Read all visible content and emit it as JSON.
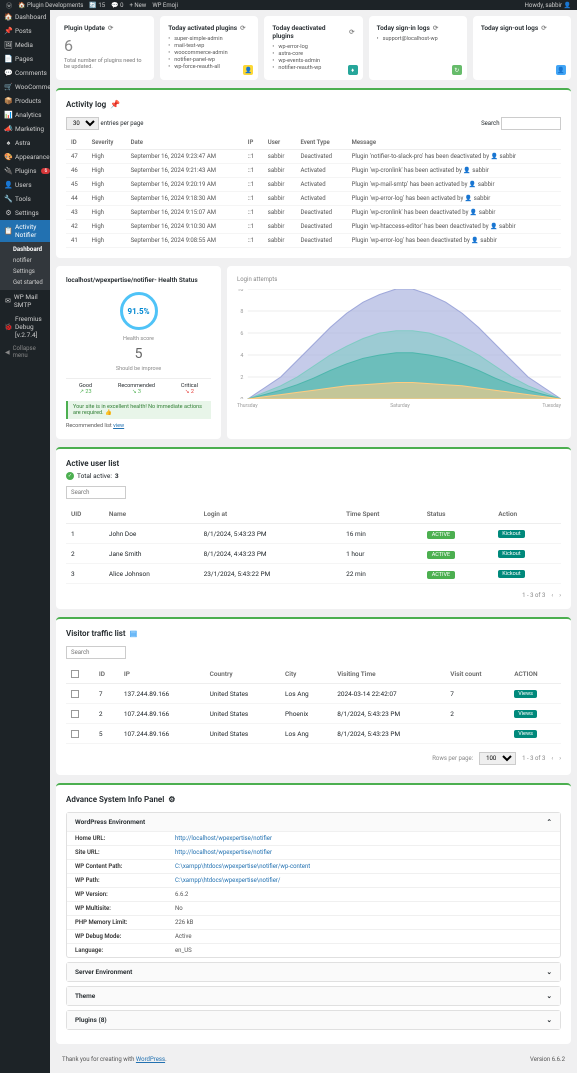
{
  "adminbar": {
    "site": "Plugin Developments",
    "updates": "15",
    "comments": "0",
    "new": "New",
    "wpemoji": "WP Emoji",
    "howdy": "Howdy, sabbir"
  },
  "sidebar": {
    "items": [
      {
        "icon": "🏠",
        "label": "Dashboard"
      },
      {
        "icon": "📌",
        "label": "Posts"
      },
      {
        "icon": "🖼",
        "label": "Media"
      },
      {
        "icon": "📄",
        "label": "Pages"
      },
      {
        "icon": "💬",
        "label": "Comments"
      },
      {
        "icon": "🛒",
        "label": "WooCommerce"
      },
      {
        "icon": "📦",
        "label": "Products"
      },
      {
        "icon": "📊",
        "label": "Analytics"
      },
      {
        "icon": "📣",
        "label": "Marketing"
      },
      {
        "icon": "♠",
        "label": "Astra"
      },
      {
        "icon": "🎨",
        "label": "Appearance"
      },
      {
        "icon": "🔌",
        "label": "Plugins",
        "badge": "6"
      },
      {
        "icon": "👤",
        "label": "Users"
      },
      {
        "icon": "🔧",
        "label": "Tools"
      },
      {
        "icon": "⚙",
        "label": "Settings"
      },
      {
        "icon": "📋",
        "label": "Activity Notifier",
        "current": true
      },
      {
        "icon": "✉",
        "label": "WP Mail SMTP"
      },
      {
        "icon": "🐞",
        "label": "Freemius Debug [v.2.7.4]"
      }
    ],
    "sub": [
      "Dashboard",
      "notifier",
      "Settings",
      "Get started"
    ],
    "collapse": "Collapse menu"
  },
  "cards": {
    "update": {
      "title": "Plugin Update",
      "count": "6",
      "note": "Total number of plugins need to be updated."
    },
    "activated": {
      "title": "Today activated plugins",
      "items": [
        "super-simple-admin",
        "mail-test-wp",
        "woocommerce-admin",
        "notifier-panel-wp",
        "wp-force-reauth-all"
      ]
    },
    "deactivated": {
      "title": "Today deactivated plugins",
      "items": [
        "wp-error-log",
        "astra-core",
        "wp-events-admin",
        "notifier-reauth-wp"
      ]
    },
    "signin": {
      "title": "Today sign-in logs",
      "items": [
        "support@localhost-wp"
      ]
    },
    "signout": {
      "title": "Today sign-out logs",
      "items": []
    }
  },
  "activity": {
    "title": "Activity log",
    "perpage": "30",
    "perpage_label": "entries per page",
    "search": "Search",
    "headers": [
      "ID",
      "Severity",
      "Date",
      "IP",
      "User",
      "Event Type",
      "Message"
    ],
    "rows": [
      {
        "id": "47",
        "sev": "High",
        "date": "September 16, 2024 9:23:47 AM",
        "ip": "::1",
        "user": "sabbir",
        "event": "Deactivated",
        "msg": "Plugin 'notifier-to-slack-pro' has been deactivated by 👤 sabbir"
      },
      {
        "id": "46",
        "sev": "High",
        "date": "September 16, 2024 9:21:43 AM",
        "ip": "::1",
        "user": "sabbir",
        "event": "Activated",
        "msg": "Plugin 'wp-cronlink' has been activated by 👤 sabbir"
      },
      {
        "id": "45",
        "sev": "High",
        "date": "September 16, 2024 9:20:19 AM",
        "ip": "::1",
        "user": "sabbir",
        "event": "Activated",
        "msg": "Plugin 'wp-mail-smtp' has been activated by 👤 sabbir"
      },
      {
        "id": "44",
        "sev": "High",
        "date": "September 16, 2024 9:18:30 AM",
        "ip": "::1",
        "user": "sabbir",
        "event": "Activated",
        "msg": "Plugin 'wp-error-log' has been activated by 👤 sabbir"
      },
      {
        "id": "43",
        "sev": "High",
        "date": "September 16, 2024 9:15:07 AM",
        "ip": "::1",
        "user": "sabbir",
        "event": "Deactivated",
        "msg": "Plugin 'wp-cronlink' has been deactivated by 👤 sabbir"
      },
      {
        "id": "42",
        "sev": "High",
        "date": "September 16, 2024 9:10:30 AM",
        "ip": "::1",
        "user": "sabbir",
        "event": "Deactivated",
        "msg": "Plugin 'wp-htaccess-editor' has been deactivated by 👤 sabbir"
      },
      {
        "id": "41",
        "sev": "High",
        "date": "September 16, 2024 9:08:55 AM",
        "ip": "::1",
        "user": "sabbir",
        "event": "Deactivated",
        "msg": "Plugin 'wp-error-log' has been deactivated by 👤 sabbir"
      }
    ]
  },
  "health": {
    "title": "localhost/wpexpertise/notifier- Health Status",
    "score": "91.5%",
    "score_label": "Health score",
    "count": "5",
    "count_label": "Should be improve",
    "good": "Good",
    "good_val": "↗ 23",
    "rec": "Recommended",
    "rec_val": "↘ 3",
    "crit": "Critical",
    "crit_val": "↘ 2",
    "tip": "Your site is in excellent health! No immediate actions are required. 👍",
    "link_pre": "Recommended list ",
    "link": "view"
  },
  "chart_data": {
    "title": "Login attempts",
    "type": "area",
    "x": [
      "Thursday",
      "Saturday",
      "Tuesday"
    ],
    "series": [
      {
        "name": "s1",
        "color": "#9fa8da",
        "values": [
          0,
          10,
          20,
          35,
          50,
          65,
          78,
          88,
          95,
          100,
          100,
          95,
          88,
          78,
          65,
          50,
          35,
          20,
          10,
          0
        ]
      },
      {
        "name": "s2",
        "color": "#80cbc4",
        "values": [
          0,
          6,
          12,
          20,
          30,
          40,
          48,
          55,
          60,
          62,
          62,
          60,
          55,
          48,
          40,
          30,
          20,
          12,
          6,
          0
        ]
      },
      {
        "name": "s3",
        "color": "#4db6ac",
        "values": [
          0,
          4,
          8,
          13,
          19,
          26,
          32,
          37,
          40,
          42,
          42,
          40,
          37,
          32,
          26,
          19,
          13,
          8,
          4,
          0
        ]
      },
      {
        "name": "s4",
        "color": "#ffcc80",
        "values": [
          0,
          2,
          4,
          6,
          8,
          10,
          12,
          13,
          14,
          15,
          15,
          14,
          13,
          12,
          10,
          8,
          6,
          4,
          2,
          0
        ]
      }
    ],
    "ylim": [
      0,
      100
    ]
  },
  "active_users": {
    "title": "Active user list",
    "total": "Total active:",
    "total_val": "3",
    "search": "Search",
    "headers": [
      "UID",
      "Name",
      "Login at",
      "Time Spent",
      "Status",
      "Action"
    ],
    "rows": [
      {
        "uid": "1",
        "name": "John Doe",
        "login": "8/1/2024, 5:43:23 PM",
        "time": "16 min",
        "status": "ACTIVE",
        "action": "Kickout"
      },
      {
        "uid": "2",
        "name": "Jane Smith",
        "login": "8/1/2024, 4:43:23 PM",
        "time": "1 hour",
        "status": "ACTIVE",
        "action": "Kickout"
      },
      {
        "uid": "3",
        "name": "Alice Johnson",
        "login": "23/1/2024, 5:43:22 PM",
        "time": "22 min",
        "status": "ACTIVE",
        "action": "Kickout"
      }
    ],
    "pagination": "1 - 3 of 3"
  },
  "traffic": {
    "title": "Visitor traffic list",
    "search": "Search",
    "headers": [
      "",
      "ID",
      "IP",
      "Country",
      "City",
      "Visiting Time",
      "Visit count",
      "ACTION"
    ],
    "rows": [
      {
        "id": "7",
        "ip": "137.244.89.166",
        "country": "United States",
        "city": "Los Ang",
        "time": "2024-03-14 22:42:07",
        "count": "7",
        "action": "Views"
      },
      {
        "id": "2",
        "ip": "107.244.89.166",
        "country": "United States",
        "city": "Phoenix",
        "time": "8/1/2024, 5:43:23 PM",
        "count": "2",
        "action": "Views"
      },
      {
        "id": "5",
        "ip": "107.244.89.166",
        "country": "United States",
        "city": "Los Ang",
        "time": "8/1/2024, 5:43:23 PM",
        "count": "",
        "action": "Views"
      }
    ],
    "rows_per": "Rows per page:",
    "rows_val": "100",
    "pagination": "1 - 3 of 3"
  },
  "sysinfo": {
    "title": "Advance System Info Panel",
    "wp_env": "WordPress Environment",
    "rows": [
      {
        "label": "Home URL:",
        "value": "http://localhost/wpexpertise/notifier",
        "link": true
      },
      {
        "label": "Site URL:",
        "value": "http://localhost/wpexpertise/notifier",
        "link": true
      },
      {
        "label": "WP Content Path:",
        "value": "C:\\xampp\\htdocs\\wpexpertise\\notifier/wp-content",
        "link": true
      },
      {
        "label": "WP Path:",
        "value": "C:\\xampp\\htdocs\\wpexpertise\\notifier/",
        "link": true
      },
      {
        "label": "WP Version:",
        "value": "6.6.2"
      },
      {
        "label": "WP Multisite:",
        "value": "No"
      },
      {
        "label": "PHP Memory Limit:",
        "value": "226 kB"
      },
      {
        "label": "WP Debug Mode:",
        "value": "Active"
      },
      {
        "label": "Language:",
        "value": "en_US"
      }
    ],
    "server": "Server Environment",
    "theme": "Theme",
    "plugins": "Plugins (8)"
  },
  "footer": {
    "thanks_pre": "Thank you for creating with ",
    "wp": "WordPress",
    "version": "Version 6.6.2"
  }
}
